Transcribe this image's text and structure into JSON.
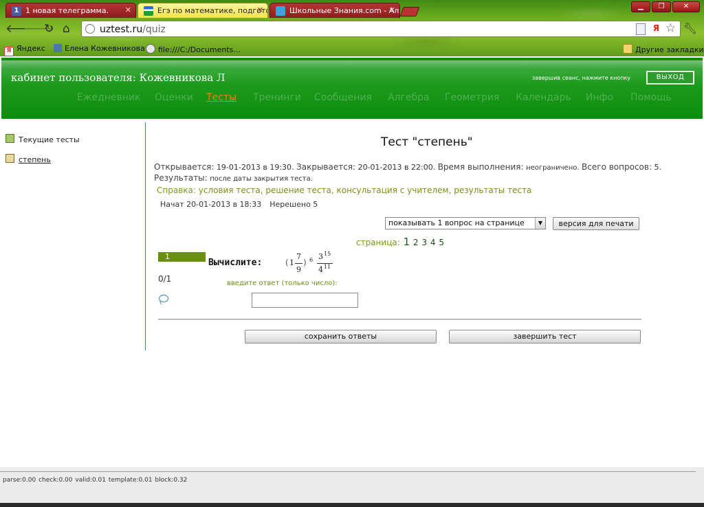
{
  "browser": {
    "tabs": [
      {
        "label": "1 новая телеграмма.",
        "favicon": "1",
        "active": false
      },
      {
        "label": "Егэ по математике, подготов",
        "favicon": "",
        "active": true
      },
      {
        "label": "Школьные Знания.com - Алге",
        "favicon": "",
        "active": false
      }
    ],
    "url": {
      "host": "uztest.ru",
      "path": "/quiz"
    },
    "bookmarks": [
      {
        "label": "Яндекс"
      },
      {
        "label": "Елена Кожевникова"
      },
      {
        "label": "file:///C:/Documents..."
      }
    ],
    "other_bookmarks": "Другие закладки"
  },
  "header": {
    "cabinet": "кабинет пользователя: Кожевникова Л",
    "logout_hint": "завершив сеанс, нажмите кнопку",
    "logout_label": "ВЫХОД",
    "nav": [
      {
        "label": "Ежедневник"
      },
      {
        "label": "Оценки"
      },
      {
        "label": "Тесты",
        "active": true
      },
      {
        "label": "Тренинги"
      },
      {
        "label": "Сообщения"
      },
      {
        "label": "Алгебра"
      },
      {
        "label": "Геометрия"
      },
      {
        "label": "Календарь"
      },
      {
        "label": "Инфо"
      },
      {
        "label": "Помощь"
      }
    ]
  },
  "sidebar": {
    "items": [
      {
        "label": "Текущие тесты"
      },
      {
        "label": "степень"
      }
    ]
  },
  "quiz": {
    "title": "Тест \"степень\"",
    "opens_label": "Открывается:",
    "opens_value": "19-01-2013 в 19:30.",
    "closes_label": "Закрывается:",
    "closes_value": "20-01-2013 в 22:00.",
    "duration_label": "Время выполнения:",
    "duration_value": "неограничено.",
    "questions_label": "Всего вопросов:",
    "questions_value": "5.",
    "results_label": "Результаты:",
    "results_value": "после даты закрытия теста.",
    "help_label": "Справка:",
    "help_links": [
      "условия теста",
      "решение теста",
      "консультация с учителем",
      "результаты теста"
    ],
    "started": "Начат 20-01-2013 в 18:33",
    "unsolved": "Нерешено 5",
    "per_page_selected": "показывать 1 вопрос на странице",
    "print_label": "версия для печати",
    "page_label": "страница:",
    "pages": [
      "1",
      "2",
      "3",
      "4",
      "5"
    ],
    "current_page": "1",
    "question_number": "1",
    "score": "0/1",
    "question_text": "Вычислите:",
    "formula": {
      "whole": "1",
      "frac_num": "7",
      "frac_den": "9",
      "power": "6",
      "num_base": "3",
      "num_exp": "15",
      "den_base": "4",
      "den_exp": "11"
    },
    "answer_label": "введите ответ (только число):",
    "answer_value": "",
    "save_label": "сохранить ответы",
    "finish_label": "завершить тест"
  },
  "footer": {
    "stats": "parse:0.00   check:0.00   valid:0.01   template:0.01   block:0.32"
  },
  "colors": {
    "header_green": "#1c9a1c",
    "nav_active": "#ff7a12",
    "accent_olive": "#7a9a1a",
    "question_badge": "#6b8f12"
  }
}
